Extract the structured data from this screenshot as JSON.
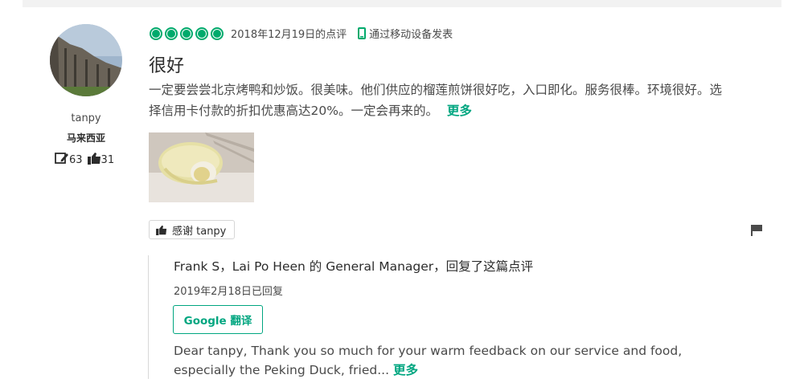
{
  "review": {
    "reviewer": {
      "name": "tanpy",
      "location": "马来西亚",
      "contributions": "63",
      "helpful_votes": "31"
    },
    "rating": 5,
    "date": "2018年12月19日的点评",
    "via_mobile": "通过移动设备发表",
    "title": "很好",
    "body": "一定要尝尝北京烤鸭和炒饭。很美味。他们供应的榴莲煎饼很好吃，入口即化。服务很棒。环境很好。选择信用卡付款的折扣优惠高达20%。一定会再来的。",
    "more_label": "更多",
    "thank_label": "感谢 tanpy"
  },
  "response": {
    "header": "Frank S，Lai Po Heen 的 General Manager，回复了这篇点评",
    "date": "2019年2月18日已回复",
    "translate_label": "Google 翻译",
    "body": "Dear tanpy, Thank you so much for your warm feedback on our service and food, especially the Peking Duck, fried...",
    "more_label": "更多"
  },
  "colors": {
    "accent": "#00aa6c",
    "link": "#00a680",
    "text": "#4a4a4a"
  },
  "icons": [
    "rating-bubble-icon",
    "mobile-icon",
    "review-count-icon",
    "thumbs-up-icon",
    "flag-icon"
  ]
}
